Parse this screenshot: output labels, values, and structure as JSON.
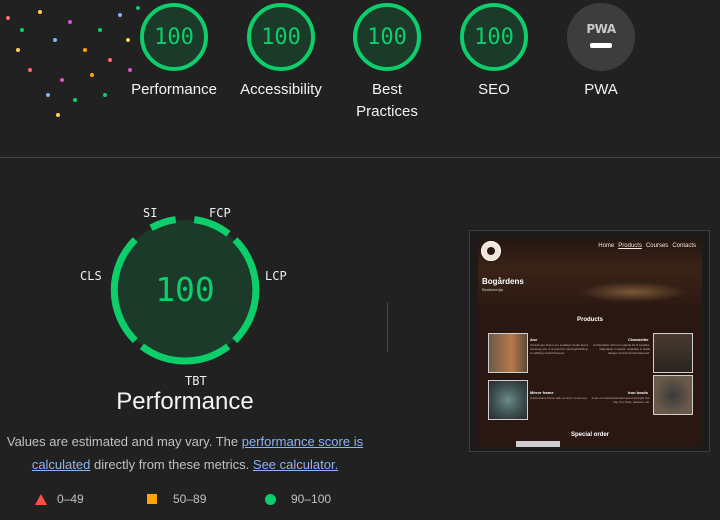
{
  "categories": [
    {
      "label": "Performance",
      "score": "100"
    },
    {
      "label": "Accessibility",
      "score": "100"
    },
    {
      "label": "Best Practices",
      "score": "100"
    },
    {
      "label": "SEO",
      "score": "100"
    },
    {
      "label": "PWA",
      "logo_text": "PWA",
      "icon": "pwa-dash-icon"
    }
  ],
  "detail": {
    "title": "Performance",
    "score": "100",
    "metrics": [
      "SI",
      "FCP",
      "LCP",
      "TBT",
      "CLS"
    ],
    "note_prefix": "Values are estimated and may vary. The ",
    "note_link1": "performance score is calculated",
    "note_middle": " directly from these metrics. ",
    "note_link2": "See calculator."
  },
  "legend": [
    {
      "range": "0–49",
      "icon": "triangle-fail-icon",
      "color": "#ff4e42"
    },
    {
      "range": "50–89",
      "icon": "square-average-icon",
      "color": "#ffa400"
    },
    {
      "range": "90–100",
      "icon": "circle-pass-icon",
      "color": "#0cce6b"
    }
  ],
  "screenshot": {
    "nav": [
      "Home",
      "Products",
      "Courses",
      "Contacts"
    ],
    "brand": "Bogårdens",
    "brand_sub": "Bladsmedja",
    "section": "Products",
    "products": [
      {
        "name": "Axe",
        "desc": "A hand axe that is our smallest model and a camping axe. It is good for carving/whittling, or splitting small firewood."
      },
      {
        "name": "Chandelier",
        "desc": "A chandelier with iron stands for 8 candles. Adjustable in height. Available in black lacquer and brownish laquered."
      },
      {
        "name": "Mirror frame",
        "desc": "A decorative frame with a mirror on the top."
      },
      {
        "name": "Iron bowls",
        "desc": "A set of ornamental hammered wrought iron tray. For fruits, pastries, etc."
      }
    ],
    "special": "Special order"
  },
  "colors": {
    "pass": "#0cce6b",
    "pass_bg": "#1b3a2a",
    "link": "#8ab4f8",
    "background": "#212121"
  }
}
